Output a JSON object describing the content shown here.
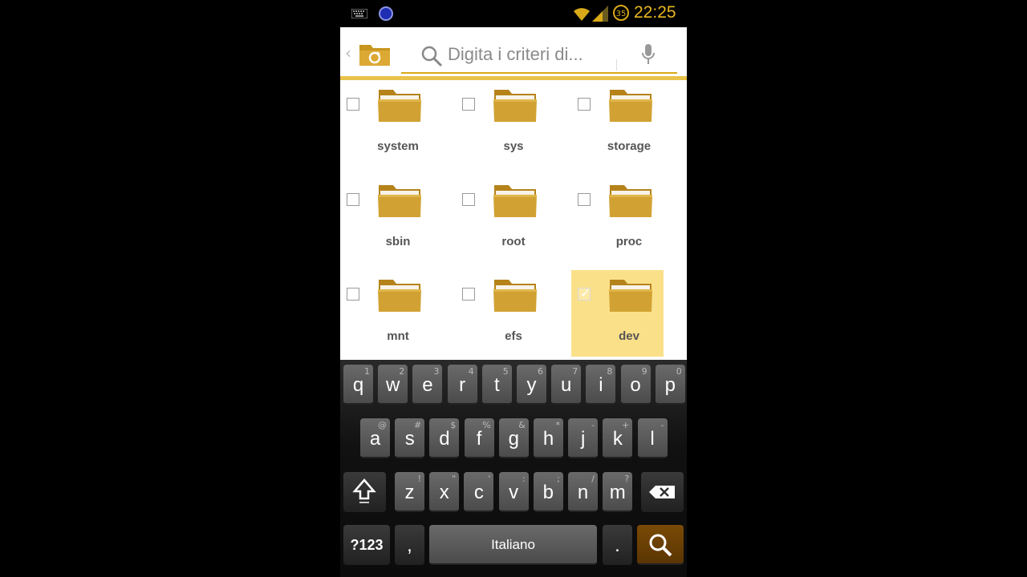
{
  "status_bar": {
    "time": "22:25",
    "battery_level": "35",
    "icons": [
      "keyboard-icon",
      "notification-circle-icon",
      "wifi-icon",
      "signal-icon",
      "battery-icon"
    ]
  },
  "top_bar": {
    "back_glyph": "‹",
    "search_placeholder": "Digita i criteri di...",
    "icons": [
      "back-chevron-icon",
      "file-manager-app-icon",
      "search-icon",
      "microphone-icon"
    ]
  },
  "folders": [
    {
      "name": "system",
      "selected": false
    },
    {
      "name": "sys",
      "selected": false
    },
    {
      "name": "storage",
      "selected": false
    },
    {
      "name": "sbin",
      "selected": false
    },
    {
      "name": "root",
      "selected": false
    },
    {
      "name": "proc",
      "selected": false
    },
    {
      "name": "mnt",
      "selected": false
    },
    {
      "name": "efs",
      "selected": false
    },
    {
      "name": "dev",
      "selected": true
    }
  ],
  "keyboard": {
    "row1": [
      {
        "k": "q",
        "s": "1"
      },
      {
        "k": "w",
        "s": "2"
      },
      {
        "k": "e",
        "s": "3"
      },
      {
        "k": "r",
        "s": "4"
      },
      {
        "k": "t",
        "s": "5"
      },
      {
        "k": "y",
        "s": "6"
      },
      {
        "k": "u",
        "s": "7"
      },
      {
        "k": "i",
        "s": "8"
      },
      {
        "k": "o",
        "s": "9"
      },
      {
        "k": "p",
        "s": "0"
      }
    ],
    "row2": [
      {
        "k": "a",
        "s": "@"
      },
      {
        "k": "s",
        "s": "#"
      },
      {
        "k": "d",
        "s": "$"
      },
      {
        "k": "f",
        "s": "%"
      },
      {
        "k": "g",
        "s": "&"
      },
      {
        "k": "h",
        "s": "*"
      },
      {
        "k": "j",
        "s": "-"
      },
      {
        "k": "k",
        "s": "+"
      },
      {
        "k": "l",
        "s": "-"
      }
    ],
    "row3": [
      {
        "k": "z",
        "s": "!"
      },
      {
        "k": "x",
        "s": "\""
      },
      {
        "k": "c",
        "s": "'"
      },
      {
        "k": "v",
        "s": ":"
      },
      {
        "k": "b",
        "s": ";"
      },
      {
        "k": "n",
        "s": "/"
      },
      {
        "k": "m",
        "s": "?"
      }
    ],
    "symbols_label": "?123",
    "comma_label": ",",
    "space_label": "Italiano",
    "period_label": ".",
    "shift_icon": "shift-arrow-icon",
    "backspace_icon": "backspace-icon",
    "search_icon": "search-icon"
  },
  "colors": {
    "accent": "#e8c24a",
    "selection": "#fbe08a",
    "folder": "#c8951f",
    "status_time": "#e8b820"
  }
}
